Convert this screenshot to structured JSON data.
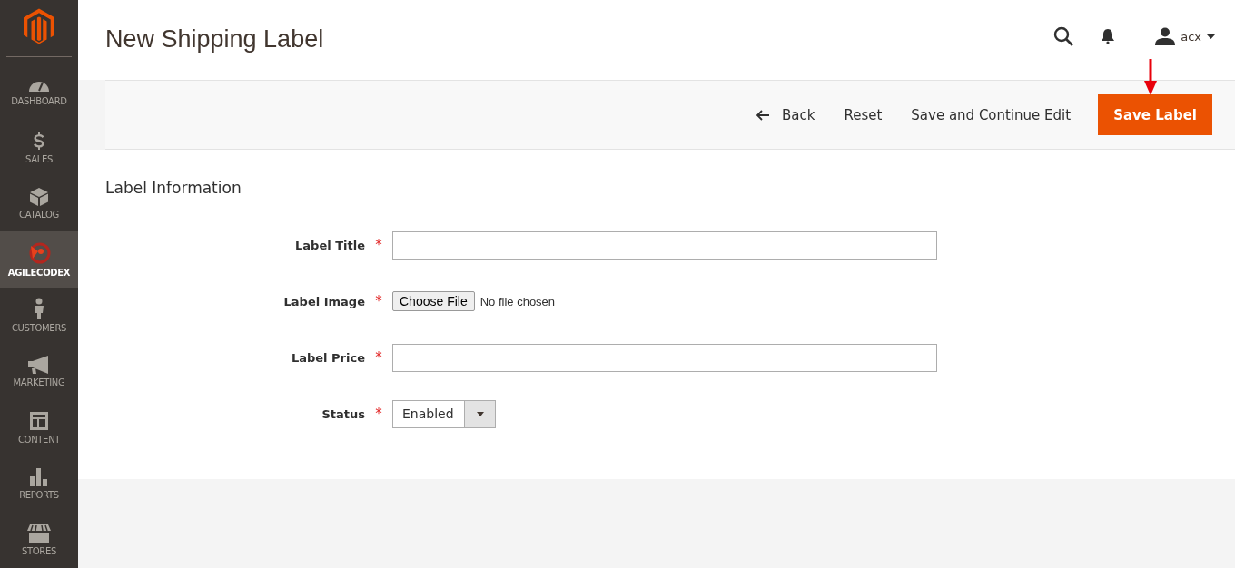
{
  "sidebar": {
    "items": [
      {
        "label": "DASHBOARD",
        "selected": false
      },
      {
        "label": "SALES",
        "selected": false
      },
      {
        "label": "CATALOG",
        "selected": false
      },
      {
        "label": "AGILECODEX",
        "selected": true
      },
      {
        "label": "CUSTOMERS",
        "selected": false
      },
      {
        "label": "MARKETING",
        "selected": false
      },
      {
        "label": "CONTENT",
        "selected": false
      },
      {
        "label": "REPORTS",
        "selected": false
      },
      {
        "label": "STORES",
        "selected": false
      }
    ]
  },
  "header": {
    "title": "New Shipping Label",
    "user": "acx"
  },
  "actions": [
    {
      "label": "Back",
      "kind": "back"
    },
    {
      "label": "Reset",
      "kind": "plain"
    },
    {
      "label": "Save and Continue Edit",
      "kind": "plain"
    },
    {
      "label": "Save Label",
      "kind": "primary"
    }
  ],
  "section": {
    "title": "Label Information"
  },
  "fields": [
    {
      "label": "Label Title",
      "required_mark": "*",
      "kind": "text"
    },
    {
      "label": "Label Image",
      "required_mark": "*",
      "kind": "file",
      "button": "Choose File",
      "value": "No file chosen"
    },
    {
      "label": "Label Price",
      "required_mark": "*",
      "kind": "text"
    },
    {
      "label": "Status",
      "required_mark": "*",
      "kind": "select",
      "value": "Enabled"
    }
  ]
}
